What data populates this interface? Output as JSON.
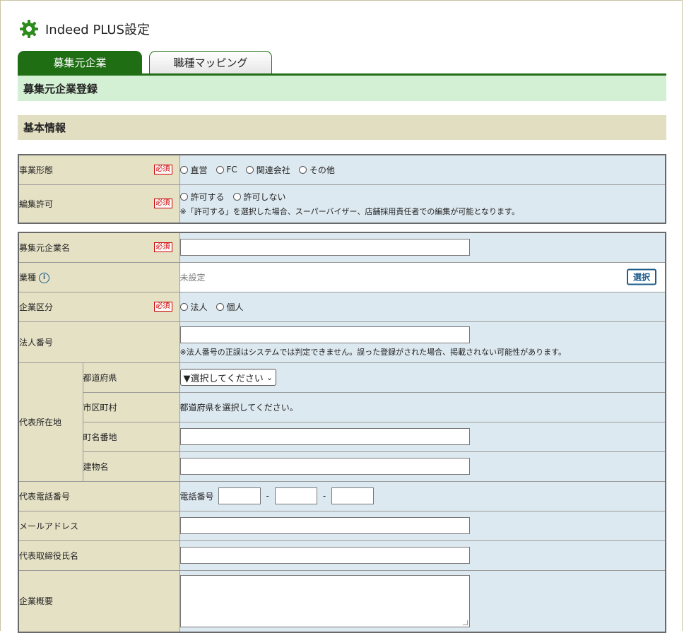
{
  "app": {
    "title": "Indeed PLUS設定",
    "icon": "gear-icon"
  },
  "tabs": [
    {
      "label": "募集元企業",
      "active": true
    },
    {
      "label": "職種マッピング",
      "active": false
    }
  ],
  "subbar": "募集元企業登録",
  "section": "基本情報",
  "required_label": "必須",
  "block1": {
    "business_type": {
      "label": "事業形態",
      "options": [
        "直営",
        "FC",
        "関連会社",
        "その他"
      ]
    },
    "edit_permission": {
      "label": "編集許可",
      "options": [
        "許可する",
        "許可しない"
      ],
      "note": "※「許可する」を選択した場合、スーパーバイザー、店舗採用責任者での編集が可能となります。"
    }
  },
  "block2": {
    "company_name": {
      "label": "募集元企業名"
    },
    "industry": {
      "label": "業種",
      "value": "未設定",
      "button": "選択",
      "info": "i"
    },
    "company_class": {
      "label": "企業区分",
      "options": [
        "法人",
        "個人"
      ]
    },
    "corp_number": {
      "label": "法人番号",
      "note": "※法人番号の正誤はシステムでは判定できません。誤った登録がされた場合、掲載されない可能性があります。"
    },
    "address": {
      "label": "代表所在地",
      "prefecture": {
        "label": "都道府県",
        "selected": "▼選択してください",
        "chevron": "⌄"
      },
      "city": {
        "label": "市区町村",
        "value": "都道府県を選択してください。"
      },
      "street": {
        "label": "町名番地"
      },
      "building": {
        "label": "建物名"
      }
    },
    "phone": {
      "label": "代表電話番号",
      "prefix": "電話番号",
      "sep": "-"
    },
    "email": {
      "label": "メールアドレス"
    },
    "ceo": {
      "label": "代表取締役氏名"
    },
    "summary": {
      "label": "企業概要"
    }
  },
  "colors": {
    "tab_green": "#1f6e14",
    "label_bg": "#e5e1c5",
    "value_bg": "#dde9f0",
    "subbar_bg": "#d4f0d4"
  }
}
